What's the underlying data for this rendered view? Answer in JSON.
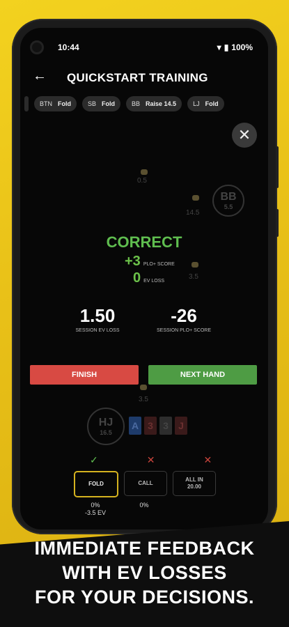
{
  "status_bar": {
    "time": "10:44",
    "battery": "100%"
  },
  "app_bar": {
    "title": "QUICKSTART TRAINING"
  },
  "action_history": [
    {
      "position": "BTN",
      "action": "Fold"
    },
    {
      "position": "SB",
      "action": "Fold"
    },
    {
      "position": "BB",
      "action": "Raise 14.5"
    },
    {
      "position": "LJ",
      "action": "Fold"
    }
  ],
  "table": {
    "top_bet": "0.5",
    "bb_seat": {
      "name": "BB",
      "stack": "5.5"
    },
    "bb_bet": "14.5",
    "right_bet": "3.5",
    "bottom_bet": "3.5",
    "hero_seat": {
      "name": "HJ",
      "stack": "16.5"
    },
    "hero_cards": [
      "A",
      "3",
      "3",
      "J"
    ]
  },
  "feedback": {
    "result": "CORRECT",
    "score_delta": "+3",
    "score_label": "PLO+ SCORE",
    "ev_loss": "0",
    "ev_loss_label": "EV LOSS",
    "session_ev_loss": "1.50",
    "session_ev_loss_label": "SESSION EV LOSS",
    "session_score": "-26",
    "session_score_label": "SESSION PLO+ SCORE"
  },
  "buttons": {
    "finish": "FINISH",
    "next_hand": "NEXT HAND"
  },
  "choices": [
    {
      "label": "FOLD",
      "sublabel": "",
      "mark": "✓",
      "mark_color": "#5fbd4f",
      "freq": "0%",
      "ev": "-3.5 EV"
    },
    {
      "label": "CALL",
      "sublabel": "",
      "mark": "✕",
      "mark_color": "#c9443c",
      "freq": "0%",
      "ev": ""
    },
    {
      "label": "ALL IN",
      "sublabel": "20.00",
      "mark": "✕",
      "mark_color": "#c9443c",
      "freq": "",
      "ev": ""
    }
  ],
  "banner": {
    "line1": "IMMEDIATE FEEDBACK",
    "line2": "WITH EV LOSSES",
    "line3": "FOR YOUR DECISIONS."
  },
  "colors": {
    "accent": "#f3d21f",
    "correct": "#5fbd4f",
    "finish": "#d84a43",
    "next": "#4e9c44"
  }
}
